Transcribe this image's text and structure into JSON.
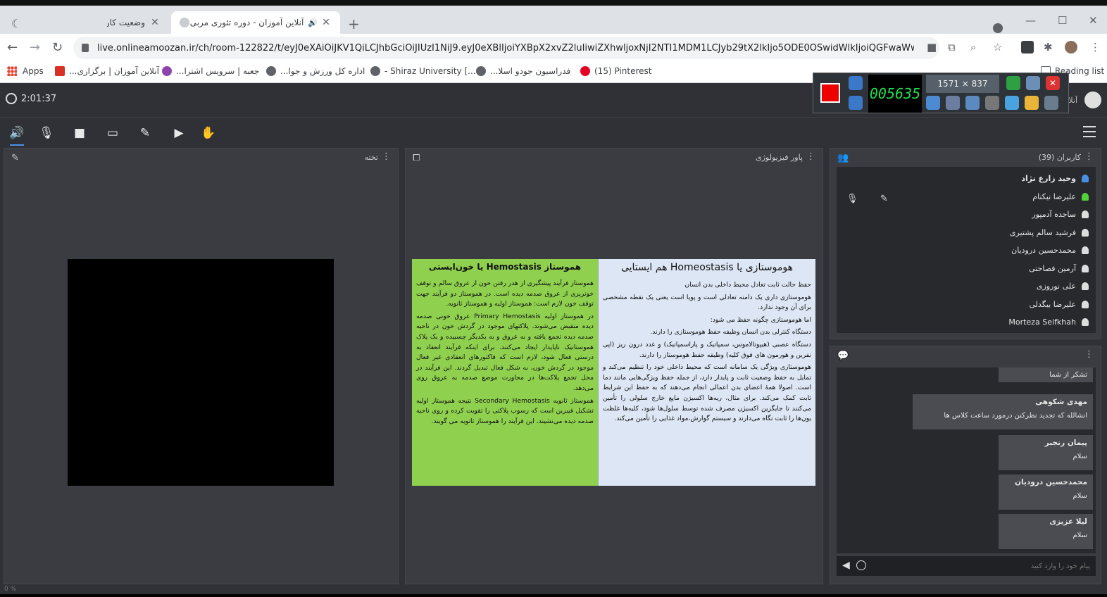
{
  "browser": {
    "tabs": [
      {
        "title": "وضعیت کاربر",
        "close": "✕"
      },
      {
        "title": "آنلاین آموزان - دوره تئوری مربی",
        "close": "✕"
      }
    ],
    "new_tab": "+",
    "url": "live.onlineamoozan.ir/ch/room-122822/t/eyJ0eXAiOiJKV1QiLCJhbGciOiJIUzI1NiJ9.eyJ0eXBlIjoiYXBpX2xvZ2luIiwiZXhwljoxNjI2NTI1MDM1LCJyb29tX2lkIjo5ODE0OSwidWlkIjoiQGFwaWwvMTA...",
    "bookmarks": [
      {
        "label": "Apps",
        "color": "#ea4335"
      },
      {
        "label": "آنلاین آموزان | برگزاری...",
        "color": "#d93025"
      },
      {
        "label": "جعبه | سرویس اشترا...",
        "color": "#8e44ad"
      },
      {
        "label": "اداره کل ورزش و جوا...",
        "color": "#5f6368"
      },
      {
        "label": "- Shiraz University [...",
        "color": "#5f6368"
      },
      {
        "label": "فدراسیون جودو اسلا...",
        "color": "#5f6368"
      },
      {
        "label": "(15) Pinterest",
        "color": "#e60023"
      }
    ],
    "reading_list": "Reading list"
  },
  "recorder": {
    "timer": "005635",
    "size": "1571 × 837",
    "colors": {
      "record": "#e00000",
      "timer_text": "#1fe04a"
    }
  },
  "app": {
    "elapsed": "2:01:37",
    "appname": "آنلاین",
    "whiteboard_title": "تخته",
    "presentation_title": "پاور فیزیولوژی",
    "users_title": "کاربران (39)",
    "users": [
      {
        "name": "وحید زارع نژاد",
        "color": "#4a90e2",
        "bold": true
      },
      {
        "name": "علیرضا نیکنام",
        "color": "#52d13b",
        "bold": false
      },
      {
        "name": "ساجده آدمپور",
        "color": "#dddddd",
        "bold": false
      },
      {
        "name": "فرشید سالم پشتیری",
        "color": "#dddddd",
        "bold": false
      },
      {
        "name": "محمدحسین درودیان",
        "color": "#dddddd",
        "bold": false
      },
      {
        "name": "آرمین فصاحتی",
        "color": "#dddddd",
        "bold": false
      },
      {
        "name": "علی نوروزی",
        "color": "#dddddd",
        "bold": false
      },
      {
        "name": "علیرضا بیگدلی",
        "color": "#dddddd",
        "bold": false
      },
      {
        "name": "Morteza Seifkhah",
        "color": "#dddddd",
        "bold": false
      }
    ],
    "chat": [
      {
        "name": "",
        "text": "تشکر از شما"
      },
      {
        "name": "مهدی شکوهی",
        "text": "انشالله که تجدید نظرکنن درمورد ساعت کلاس ها"
      },
      {
        "name": "پیمان رنجبر",
        "text": "سلام"
      },
      {
        "name": "محمدحسین درودیان",
        "text": "سلام"
      },
      {
        "name": "لیلا عزیزی",
        "text": "سلام"
      }
    ],
    "chat_placeholder": "پیام خود را وارد کنید",
    "status_left": "0 %"
  },
  "slide": {
    "left_title": "هموستاز Hemostasis یا خون‌ایستی",
    "left_p1": "هموستاز فرآیند پیشگیری از هدر رفتن خون از عروق سالم و توقف خونریزی از عروق صدمه دیده است. در هموستاز دو فرآیند جهت توقف خون لازم است: هموستاز اولیه و هموستاز ثانویه.",
    "left_p2": "در هموستاز اولیه Primary Hemostasis عروق خونی صدمه دیده منقبض می‌شوند. پلاکتهای موجود در گردش خون در ناحیه صدمه دیده تجمع یافته و به عروق و به یکدیگر چسبیده و یک پلاک هموستاتیک ناپایدار ایجاد می‌کنند. برای اینکه فرآیند انعقاد به درستی فعال شود، لازم است که فاکتورهای انعقادی غیر فعال موجود در گردش خون، به شکل فعال تبدیل گردند. این فرآیند در محل تجمع پلاکت‌ها در مجاورت موضع صدمه به عروق روی می‌دهد.",
    "left_p3": "هموستاز ثانویه Secondary Hemostasis نتیجه هموستاز اولیه تشکیل فیبرین است که رسوب پلاکتی را تقویت کرده و روی ناحیه صدمه دیده می‌نشیند. این فرآیند را هموستاز ثانویه می گویند.",
    "right_title": "هوموستازی یا Homeostasis هم ایستایی",
    "right_p1": "حفظ حالت ثابت تعادل محیط داخلی بدن انسان",
    "right_p2": "هوموستازی داری یک دامنه تعادلی است و پویا است یعنی یک نقطه مشخصی برای آن وجود ندارد.",
    "right_p3": "اما هوموستازی چگونه حفظ می شود:",
    "right_p4": "دستگاه کنترلی بدن انسان وظیفه حفظ هوموستازی را دارند.",
    "right_p5": "دستگاه عصبی (هیپوتالاموس، سمپاتیک و پاراسمپاتیک) و غدد درون ریز (اپی نفرین و هورمون های فوق کلیه) وظیفه حفظ هوموستاز را دارند.",
    "right_p6": "هوموستازی ویژگی یک سامانه است که محیط داخلی خود را تنظیم می‌کند و تمایل به حفظ وضعیت ثابت و پایدار دارد، از جمله حفظ ویژگی‌هایی مانند دما است. اصولا همهٔ اعضای بدن اعمالی انجام می‌دهند که به حفظ این شرایط ثابت کمک می‌کند. برای مثال، ریه‌ها اکسیژن مایع خارج سلولی را تأمین می‌کنند تا جایگزین اکسیژن مصرف شده توسط سلول‌ها شود، کلیه‌ها غلظت یون‌ها را ثابت نگاه می‌دارند و سیستم گوارش،مواد غذایی را تأمین می‌کند.",
    "colors": {
      "left_bg": "#8fd14f",
      "right_bg": "#dde6f4"
    }
  }
}
